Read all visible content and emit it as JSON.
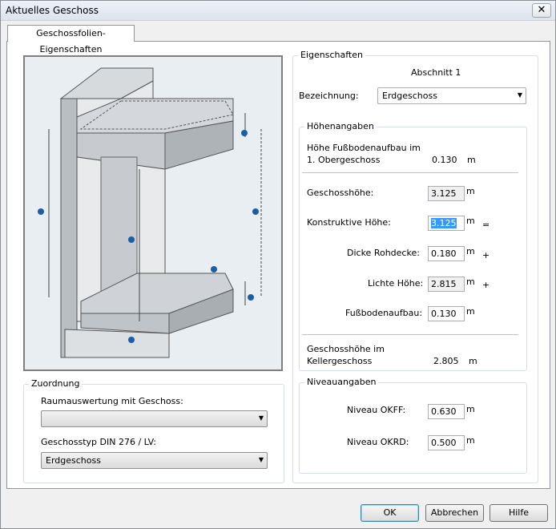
{
  "window": {
    "title": "Aktuelles Geschoss",
    "close_glyph": "✕"
  },
  "tab": {
    "label": "Geschossfolien-Eigenschaften"
  },
  "eigenschaften": {
    "group_label": "Eigenschaften",
    "abschnitt": "Abschnitt 1",
    "bezeichnung_label": "Bezeichnung:",
    "bezeichnung_value": "Erdgeschoss"
  },
  "hoehen": {
    "group_label": "Höhenangaben",
    "fussboden_og_label_1": "Höhe Fußbodenaufbau im",
    "fussboden_og_label_2": "1. Obergeschoss",
    "fussboden_og_value": "0.130",
    "geschosshoehe_label": "Geschosshöhe:",
    "geschosshoehe_value": "3.125",
    "konstruktive_label": "Konstruktive Höhe:",
    "konstruktive_value": "3.125",
    "dicke_label": "Dicke Rohdecke:",
    "dicke_value": "0.180",
    "lichte_label": "Lichte Höhe:",
    "lichte_value": "2.815",
    "fussboden_label": "Fußbodenaufbau:",
    "fussboden_value": "0.130",
    "keller_label_1": "Geschosshöhe im",
    "keller_label_2": "Kellergeschoss",
    "keller_value": "2.805",
    "unit": "m",
    "eq": "=",
    "plus": "+"
  },
  "niveau": {
    "group_label": "Niveauangaben",
    "okff_label": "Niveau OKFF:",
    "okff_value": "0.630",
    "okrd_label": "Niveau OKRD:",
    "okrd_value": "0.500",
    "unit": "m"
  },
  "zuordnung": {
    "group_label": "Zuordnung",
    "raum_label": "Raumauswertung mit Geschoss:",
    "raum_value": "",
    "typ_label": "Geschosstyp DIN 276 / LV:",
    "typ_value": "Erdgeschoss"
  },
  "buttons": {
    "ok": "OK",
    "cancel": "Abbrechen",
    "help": "Hilfe"
  }
}
